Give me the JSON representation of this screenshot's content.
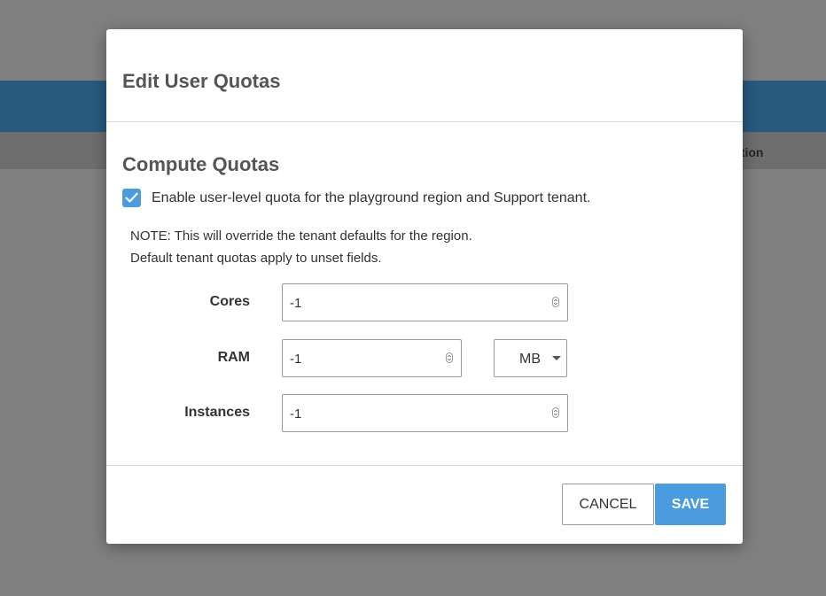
{
  "background": {
    "subbar_text": "ation"
  },
  "dialog": {
    "title": "Edit User Quotas",
    "section_title": "Compute Quotas",
    "enable_checkbox": {
      "checked": true,
      "label": "Enable user-level quota for the playground region and Support tenant."
    },
    "note_lines": [
      "NOTE: This will override the tenant defaults for the region.",
      "Default tenant quotas apply to unset fields."
    ],
    "fields": {
      "cores": {
        "label": "Cores",
        "value": "-1"
      },
      "ram": {
        "label": "RAM",
        "value": "-1",
        "unit": "MB"
      },
      "instances": {
        "label": "Instances",
        "value": "-1"
      }
    },
    "buttons": {
      "cancel": "CANCEL",
      "save": "SAVE"
    }
  },
  "colors": {
    "overlay": "#808080",
    "header_bg": "#275a7e",
    "accent": "#4a9be0",
    "title_text": "#555555"
  },
  "icons": {
    "checkbox": "check-icon",
    "spinner": "spinner-arrows-icon",
    "select": "caret-down-icon"
  }
}
